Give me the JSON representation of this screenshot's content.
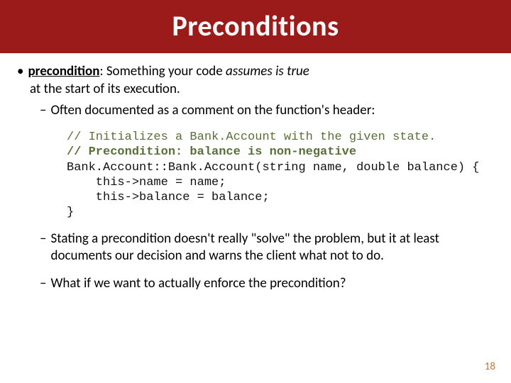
{
  "title": "Preconditions",
  "bullet1": {
    "marker": "•",
    "term": "precondition",
    "after_term": ": Something your code ",
    "em": "assumes is true",
    "continuation": "at the start of its execution."
  },
  "dash1": {
    "marker": "–",
    "text": "Often documented as a comment on the function's header:"
  },
  "code": {
    "c1": "// Initializes a Bank.Account with the given state.",
    "c2": "// Precondition: balance is non-negative",
    "l3": "Bank.Account::Bank.Account(string name, double balance) {",
    "l4": "    this->name = name;",
    "l5": "    this->balance = balance;",
    "l6": "}"
  },
  "dash2": {
    "marker": "–",
    "text": "Stating a precondition doesn't really \"solve\" the problem, but it at least documents our decision and warns the client what not to do."
  },
  "dash3": {
    "marker": "–",
    "text": "What if we want to actually enforce the precondition?"
  },
  "page_number": "18"
}
